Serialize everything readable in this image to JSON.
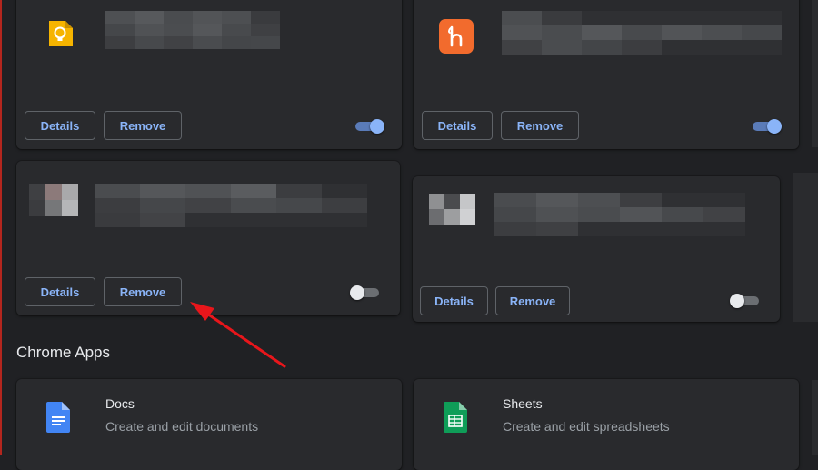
{
  "extensions": [
    {
      "details_label": "Details",
      "remove_label": "Remove",
      "enabled": true
    },
    {
      "details_label": "Details",
      "remove_label": "Remove",
      "enabled": true
    },
    {
      "details_label": "Details",
      "remove_label": "Remove",
      "enabled": false
    },
    {
      "details_label": "Details",
      "remove_label": "Remove",
      "enabled": false
    }
  ],
  "chrome_apps": {
    "title": "Chrome Apps",
    "items": [
      {
        "name": "Docs",
        "description": "Create and edit documents",
        "icon": "google-docs-icon",
        "color": "#4285f4"
      },
      {
        "name": "Sheets",
        "description": "Create and edit spreadsheets",
        "icon": "google-sheets-icon",
        "color": "#0f9d58"
      }
    ]
  },
  "colors": {
    "background": "#202124",
    "card": "#292a2d",
    "accent": "#8ab4f8",
    "annotation_arrow": "#e8161b"
  }
}
